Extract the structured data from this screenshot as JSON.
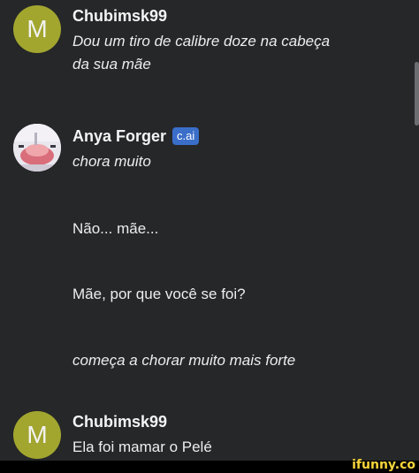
{
  "messages": [
    {
      "author": "Chubimsk99",
      "avatar_letter": "M",
      "lines": [
        "Dou um tiro de calibre doze na cabeça",
        "da sua mãe"
      ]
    },
    {
      "author": "Anya Forger",
      "badge": "c.ai",
      "lines": [
        "chora muito",
        "Não... mãe...",
        "Mãe, por que você se foi?",
        "começa a chorar muito mais forte"
      ]
    },
    {
      "author": "Chubimsk99",
      "avatar_letter": "M",
      "lines": [
        "Ela foi mamar o Pelé"
      ]
    }
  ],
  "watermark": "ifunny.co",
  "colors": {
    "background": "#262729",
    "avatar_bg": "#a2a62e",
    "badge_bg": "#3a6ec9",
    "watermark": "#f6d53a"
  }
}
